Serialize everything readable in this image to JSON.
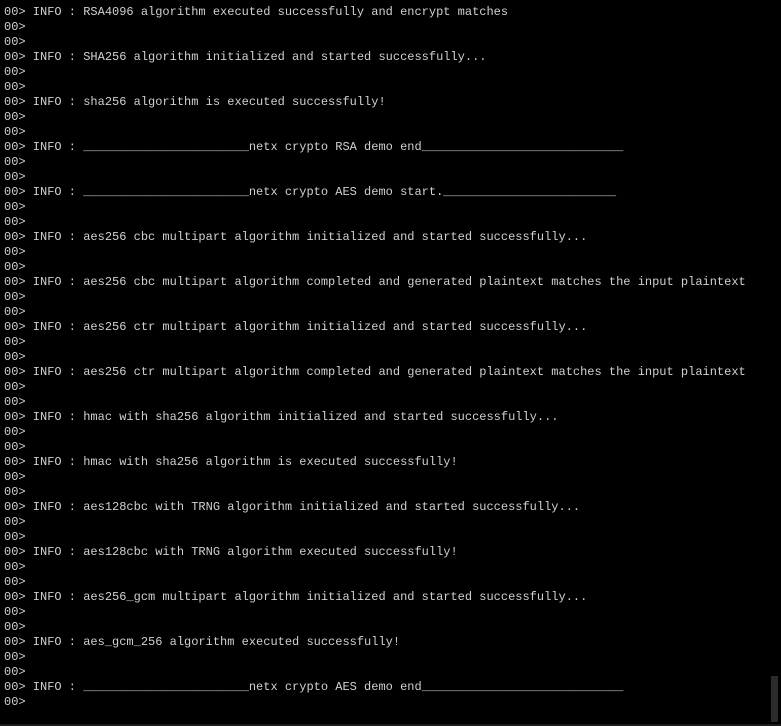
{
  "terminal": {
    "lines": [
      "00>",
      "00> INFO : RSA4096 algorithm executed successfully and encrypt matches",
      "00>",
      "00>",
      "00> INFO : SHA256 algorithm initialized and started successfully...",
      "00>",
      "00>",
      "00> INFO : sha256 algorithm is executed successfully!",
      "00>",
      "00>",
      "00> INFO : _______________________netx crypto RSA demo end____________________________",
      "00>",
      "00>",
      "00> INFO : _______________________netx crypto AES demo start.________________________",
      "00>",
      "00>",
      "00> INFO : aes256 cbc multipart algorithm initialized and started successfully...",
      "00>",
      "00>",
      "00> INFO : aes256 cbc multipart algorithm completed and generated plaintext matches the input plaintext",
      "00>",
      "00>",
      "00> INFO : aes256 ctr multipart algorithm initialized and started successfully...",
      "00>",
      "00>",
      "00> INFO : aes256 ctr multipart algorithm completed and generated plaintext matches the input plaintext",
      "00>",
      "00>",
      "00> INFO : hmac with sha256 algorithm initialized and started successfully...",
      "00>",
      "00>",
      "00> INFO : hmac with sha256 algorithm is executed successfully!",
      "00>",
      "00>",
      "00> INFO : aes128cbc with TRNG algorithm initialized and started successfully...",
      "00>",
      "00>",
      "00> INFO : aes128cbc with TRNG algorithm executed successfully!",
      "00>",
      "00>",
      "00> INFO : aes256_gcm multipart algorithm initialized and started successfully...",
      "00>",
      "00>",
      "00> INFO : aes_gcm_256 algorithm executed successfully!",
      "00>",
      "00>",
      "00> INFO : _______________________netx crypto AES demo end____________________________",
      "00>"
    ]
  },
  "colors": {
    "background": "#000000",
    "text": "#d0d0d0"
  }
}
